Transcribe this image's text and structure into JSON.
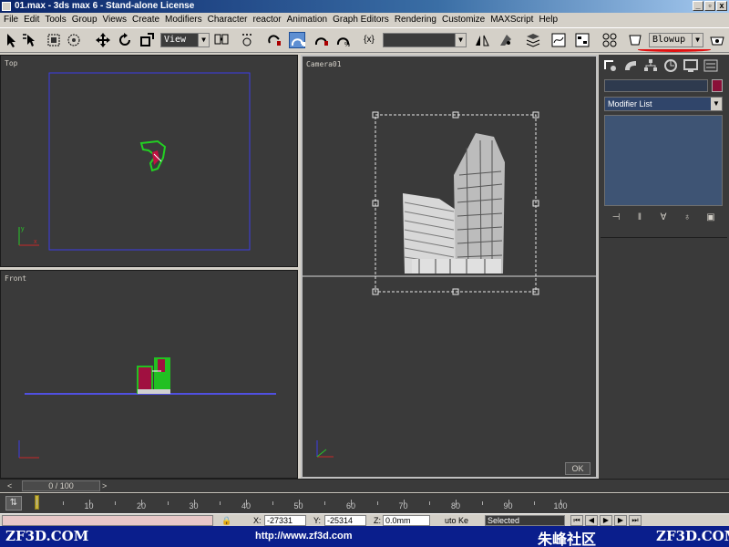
{
  "window": {
    "title": "01.max - 3ds max 6 - Stand-alone License",
    "controls": [
      "_",
      "▫",
      "x"
    ]
  },
  "menu": [
    "File",
    "Edit",
    "Tools",
    "Group",
    "Views",
    "Create",
    "Modifiers",
    "Character",
    "reactor",
    "Animation",
    "Graph Editors",
    "Rendering",
    "Customize",
    "MAXScript",
    "Help"
  ],
  "toolbar": {
    "reference_coord": "View",
    "named_selection": "",
    "render_type": "Blowup",
    "snap_icon": "{x}"
  },
  "viewports": {
    "top_label": "Top",
    "camera_label": "Camera01",
    "front_label": "Front",
    "ok_label": "OK"
  },
  "command_panel": {
    "modifier_list": "Modifier List",
    "object_color": "#8a1038"
  },
  "time_slider": {
    "position": "0 / 100",
    "left_arrow": "<",
    "right_arrow": ">"
  },
  "track_bar": {
    "ticks": [
      "10",
      "20",
      "30",
      "40",
      "50",
      "60",
      "70",
      "80",
      "90",
      "100"
    ],
    "current_frame": 0
  },
  "status_bar": {
    "x_label": "X:",
    "x_value": "-27331",
    "y_label": "Y:",
    "y_value": "-25314",
    "z_label": "Z:",
    "z_value": "0.0mm",
    "auto_key": "uto Ke",
    "selection": "Selected"
  },
  "watermark": {
    "left": "ZF3D.COM",
    "url": "http://www.zf3d.com",
    "logo": "朱峰社区",
    "right": "ZF3D.COM"
  },
  "colors": {
    "viewport_bg": "#3a3a3a",
    "accent_red": "#e01010",
    "watermark_bg": "#0a1e8c"
  }
}
